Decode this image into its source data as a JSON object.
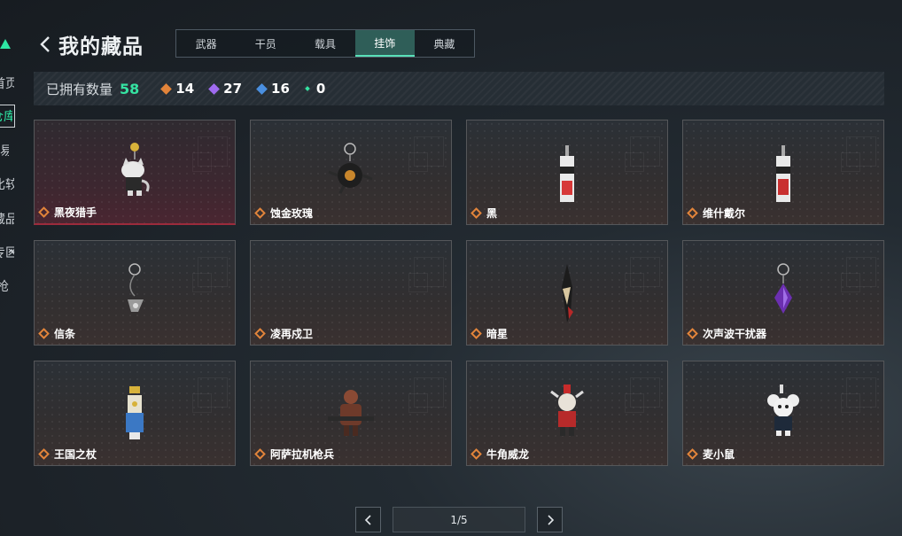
{
  "sidebar": {
    "items": [
      {
        "label": "首页"
      },
      {
        "label": "仓库"
      },
      {
        "label": "交易行"
      },
      {
        "label": "比较"
      },
      {
        "label": "藏品"
      },
      {
        "label": "专区"
      },
      {
        "label": "枪"
      }
    ]
  },
  "header": {
    "title": "我的藏品"
  },
  "tabs": [
    {
      "label": "武器"
    },
    {
      "label": "干员"
    },
    {
      "label": "载具"
    },
    {
      "label": "挂饰",
      "active": true
    },
    {
      "label": "典藏"
    }
  ],
  "stats": {
    "label": "已拥有数量",
    "total": "58",
    "counts": [
      {
        "icon": "orange-diamond-icon",
        "color": "#e2843a",
        "value": "14"
      },
      {
        "icon": "purple-diamond-icon",
        "color": "#9f6bf0",
        "value": "27"
      },
      {
        "icon": "blue-diamond-icon",
        "color": "#4a8fe0",
        "value": "16"
      },
      {
        "icon": "green-diamond-icon",
        "color": "#35e3a2",
        "value": "0"
      }
    ]
  },
  "items": [
    {
      "name": "黑夜猎手",
      "icon": "cat-figure-charm-icon"
    },
    {
      "name": "蚀金玫瑰",
      "icon": "rose-ring-charm-icon"
    },
    {
      "name": "黑",
      "icon": "red-tag-charm-icon"
    },
    {
      "name": "维什戴尔",
      "icon": "red-tag-charm-icon"
    },
    {
      "name": "信条",
      "icon": "ring-pendant-charm-icon"
    },
    {
      "name": "凌再戍卫",
      "icon": "empty-charm-icon"
    },
    {
      "name": "暗星",
      "icon": "blade-charm-icon"
    },
    {
      "name": "次声波干扰器",
      "icon": "purple-crystal-charm-icon"
    },
    {
      "name": "王国之杖",
      "icon": "scepter-charm-icon"
    },
    {
      "name": "阿萨拉机枪兵",
      "icon": "gunner-figure-charm-icon"
    },
    {
      "name": "牛角威龙",
      "icon": "horned-figure-charm-icon"
    },
    {
      "name": "麦小鼠",
      "icon": "mouse-figure-charm-icon"
    }
  ],
  "pagination": {
    "label": "1/5"
  },
  "colors": {
    "accent": "#35e3a2",
    "rarity": "#e2843a"
  }
}
